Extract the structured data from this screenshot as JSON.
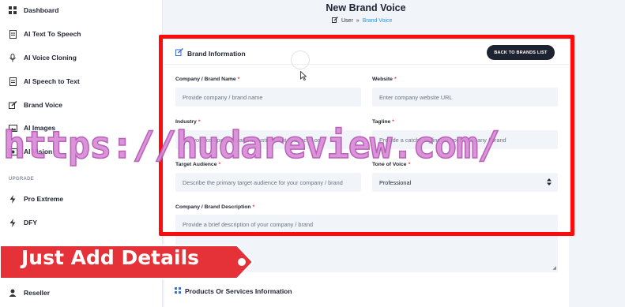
{
  "sidebar": {
    "items": [
      {
        "label": "Dashboard",
        "icon": "grid-icon"
      },
      {
        "label": "AI Text To Speech",
        "icon": "doc-icon"
      },
      {
        "label": "AI Voice Cloning",
        "icon": "mic-icon"
      },
      {
        "label": "AI Speech to Text",
        "icon": "doc-icon"
      },
      {
        "label": "Brand Voice",
        "icon": "edit-icon"
      },
      {
        "label": "AI Images",
        "icon": "image-icon"
      },
      {
        "label": "AI Vision",
        "icon": "vision-icon"
      }
    ],
    "section_upgrade": "UPGRADE",
    "upgrade_items": [
      {
        "label": "Pro Extreme",
        "icon": "bolt-icon"
      },
      {
        "label": "DFY",
        "icon": "bolt-icon"
      },
      {
        "label": "Reseller",
        "icon": "user-icon"
      }
    ]
  },
  "header": {
    "title": "New Brand Voice",
    "breadcrumb": {
      "root": "User",
      "separator": "»",
      "current": "Brand Voice"
    }
  },
  "card": {
    "title": "Brand Information",
    "back_button": "BACK TO BRANDS LIST",
    "fields": {
      "company_name": {
        "label": "Company / Brand Name",
        "placeholder": "Provide company / brand name"
      },
      "website": {
        "label": "Website",
        "placeholder": "Enter company website URL"
      },
      "industry": {
        "label": "Industry",
        "placeholder": "List your company / brand industries that you focus on"
      },
      "tagline": {
        "label": "Tagline",
        "placeholder": "Provide a catchy tagline for your company / brand"
      },
      "audience": {
        "label": "Target Audience",
        "placeholder": "Describe the primary target audience for your company / brand"
      },
      "tone": {
        "label": "Tone of Voice",
        "value": "Professional"
      },
      "description": {
        "label": "Company / Brand Description",
        "placeholder": "Provide a brief description of your company / brand"
      }
    },
    "required_mark": "*"
  },
  "section2": {
    "title": "Products Or Services Information"
  },
  "overlays": {
    "watermark": "https://hudareview.com/",
    "promo": "Just Add Details"
  },
  "colors": {
    "accent": "#3a8fd8",
    "frame": "#ff0b0b",
    "promo": "#e53238",
    "button": "#1e2331"
  }
}
